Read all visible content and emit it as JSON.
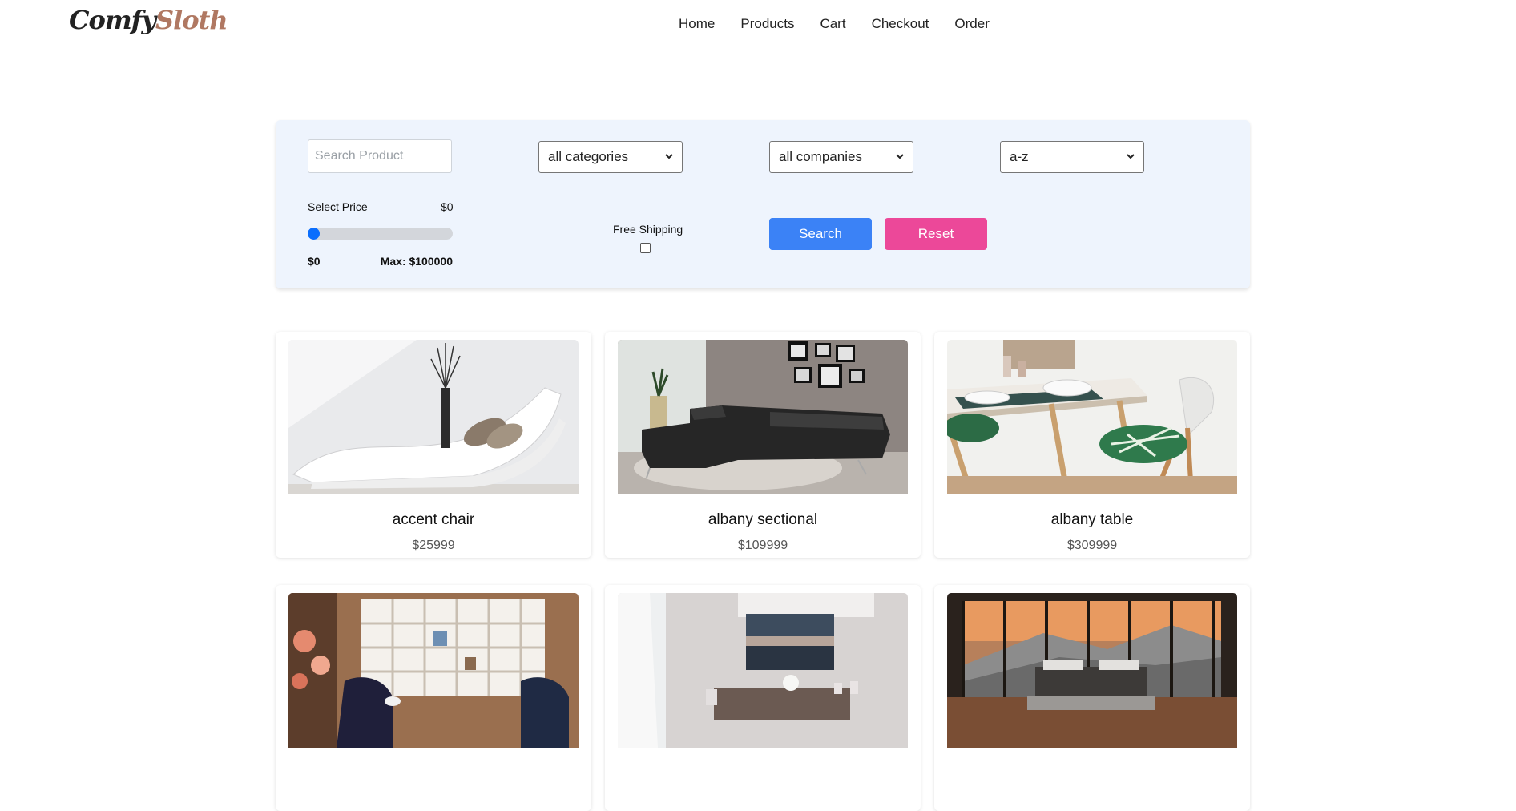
{
  "brand": {
    "part1": "Comfy",
    "part2": "Sloth"
  },
  "nav": [
    {
      "label": "Home"
    },
    {
      "label": "Products"
    },
    {
      "label": "Cart"
    },
    {
      "label": "Checkout"
    },
    {
      "label": "Order"
    }
  ],
  "filters": {
    "search_placeholder": "Search Product",
    "search_value": "",
    "category": "all categories",
    "company": "all companies",
    "sort": "a-z",
    "price_label": "Select Price",
    "price_current": "$0",
    "price_fraction": 0,
    "price_min": "$0",
    "price_max": "Max: $100000",
    "shipping_label": "Free Shipping",
    "shipping_checked": false,
    "search_button": "Search",
    "reset_button": "Reset"
  },
  "colors": {
    "accent": "#3b82f6",
    "reset": "#ec4899",
    "brand_accent": "#b07862",
    "panel_bg": "#eef4fd"
  },
  "products": [
    {
      "title": "accent chair",
      "price": "$25999",
      "image": "white-chaise-lounge"
    },
    {
      "title": "albany sectional",
      "price": "$109999",
      "image": "black-leather-sectional"
    },
    {
      "title": "albany table",
      "price": "$309999",
      "image": "dining-table-with-chair"
    },
    {
      "title": "",
      "price": "",
      "image": "bookshelf-with-armchairs"
    },
    {
      "title": "",
      "price": "",
      "image": "dining-room-with-window"
    },
    {
      "title": "",
      "price": "",
      "image": "bed-with-mountain-view"
    }
  ]
}
